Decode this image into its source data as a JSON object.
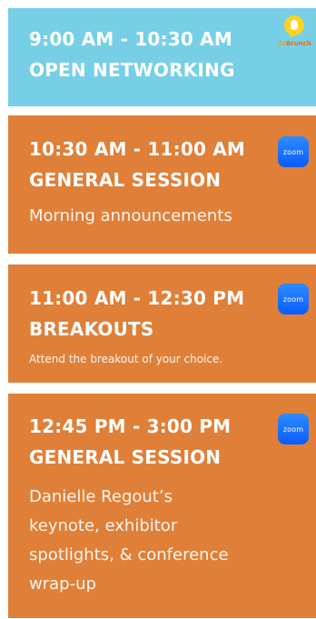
{
  "schedule": [
    {
      "time": "9:00 AM - 10:30 AM",
      "title": "OPEN NETWORKING",
      "description": "",
      "platform_icon": "gobrunch-logo",
      "platform_label_go": "Go",
      "platform_label_brunch": "Brunch",
      "color": "#76cfe7"
    },
    {
      "time": "10:30 AM - 11:00 AM",
      "title": "GENERAL SESSION",
      "description": "Morning announcements",
      "platform_icon": "zoom-icon",
      "platform_label": "zoom",
      "color": "#e07f38"
    },
    {
      "time": "11:00 AM - 12:30 PM",
      "title": "BREAKOUTS",
      "description": "Attend the breakout of your choice.",
      "platform_icon": "zoom-icon",
      "platform_label": "zoom",
      "color": "#e07f38"
    },
    {
      "time": "12:45 PM - 3:00 PM",
      "title": "GENERAL SESSION",
      "description_lines": [
        "Danielle Regout’s",
        "keynote, exhibitor",
        "spotlights, & conference",
        "wrap-up"
      ],
      "platform_icon": "zoom-icon",
      "platform_label": "zoom",
      "color": "#e07f38"
    }
  ],
  "colors": {
    "networking_bg": "#76cfe7",
    "session_bg": "#e07f38",
    "zoom_blue": "#0b5cff",
    "gobrunch_yellow": "#ffd21f"
  }
}
